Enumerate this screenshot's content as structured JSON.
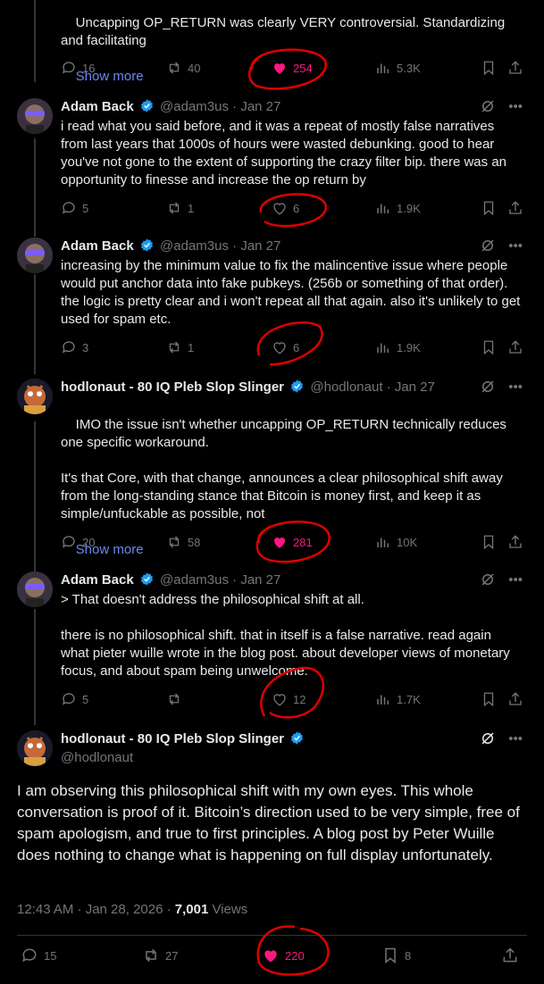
{
  "tweet0": {
    "text": "Uncapping OP_RETURN was clearly VERY controversial. Standardizing and facilitating",
    "show_more": "Show more",
    "stats": {
      "replies": "16",
      "reposts": "40",
      "likes": "254",
      "views": "5.3K"
    }
  },
  "tweet1": {
    "name": "Adam Back",
    "handle": "@adam3us",
    "sep": "·",
    "date": "Jan 27",
    "text": "i read what you said before, and it was a repeat of mostly false narratives from last years that 1000s of hours were wasted debunking. good to hear you've not gone to the extent of supporting the crazy filter bip. there was an opportunity to finesse and increase the op return by",
    "stats": {
      "replies": "5",
      "reposts": "1",
      "likes": "6",
      "views": "1.9K"
    }
  },
  "tweet2": {
    "name": "Adam Back",
    "handle": "@adam3us",
    "sep": "·",
    "date": "Jan 27",
    "text": "increasing by the minimum value to fix the malincentive issue where people would put anchor data into fake pubkeys. (256b or something of that order). the logic is pretty clear and i won't repeat all that again. also it's unlikely to get used for spam etc.",
    "stats": {
      "replies": "3",
      "reposts": "1",
      "likes": "6",
      "views": "1.9K"
    }
  },
  "tweet3": {
    "name": "hodlonaut - 80 IQ Pleb Slop Slinger",
    "handle": "@hodlonaut",
    "sep": "·",
    "date": "Jan 27",
    "text": "IMO the issue isn't whether uncapping OP_RETURN technically reduces one specific workaround.\n\nIt's that Core, with that change, announces a clear philosophical shift away from the long-standing stance that Bitcoin is money first, and keep it as simple/unfuckable as possible, not",
    "show_more": "Show more",
    "stats": {
      "replies": "20",
      "reposts": "58",
      "likes": "281",
      "views": "10K"
    }
  },
  "tweet4": {
    "name": "Adam Back",
    "handle": "@adam3us",
    "sep": "·",
    "date": "Jan 27",
    "text": "> That doesn't address the philosophical shift at all.\n\nthere is no philosophical shift. that in itself is a false narrative. read again what pieter wuille wrote in the blog post. about developer views of monetary focus, and about spam being unwelcome.",
    "stats": {
      "replies": "5",
      "reposts": "",
      "likes": "12",
      "views": "1.7K"
    }
  },
  "main": {
    "name": "hodlonaut - 80 IQ Pleb Slop Slinger",
    "handle": "@hodlonaut",
    "text": "I am observing this philosophical shift with my own eyes. This whole conversation is proof of it. Bitcoin’s direction used to be very simple, free of spam apologism, and true to first principles. A blog post by Peter Wuille does nothing to change what is happening on full display unfortunately.",
    "time": "12:43 AM · Jan 28, 2026 · ",
    "views_count": "7,001",
    "views_label": " Views",
    "stats": {
      "replies": "15",
      "reposts": "27",
      "likes": "220",
      "bookmarks": "8"
    }
  },
  "colors": {
    "like": "#f91880",
    "verified": "#1d9bf0",
    "link": "#6b8af2",
    "annotation": "#e00000"
  }
}
